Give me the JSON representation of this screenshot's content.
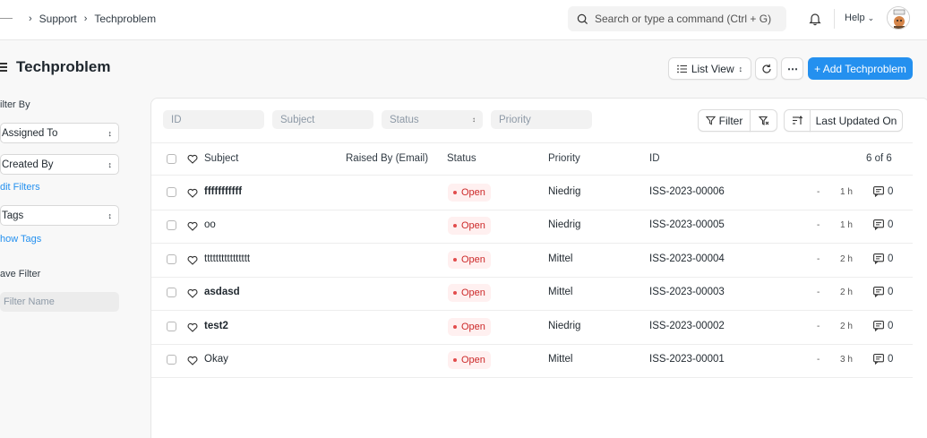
{
  "breadcrumb": {
    "items": [
      "Support",
      "Techproblem"
    ]
  },
  "search": {
    "placeholder": "Search or type a command (Ctrl + G)"
  },
  "navbar": {
    "help_label": "Help"
  },
  "page": {
    "title": "Techproblem",
    "list_view_label": "List View",
    "add_button_label": "+ Add Techproblem"
  },
  "sidebar": {
    "filter_by_label": "ilter By",
    "assigned_to_label": "Assigned To",
    "created_by_label": "Created By",
    "edit_filters_label": "dit Filters",
    "tags_label": "Tags",
    "show_tags_label": "how Tags",
    "save_filter_label": "ave Filter",
    "filter_name_placeholder": "Filter Name"
  },
  "filters": {
    "id_placeholder": "ID",
    "subject_placeholder": "Subject",
    "status_placeholder": "Status",
    "priority_placeholder": "Priority",
    "filter_button_label": "Filter",
    "sort_label": "Last Updated On"
  },
  "table": {
    "headers": {
      "subject": "Subject",
      "raised_by": "Raised By (Email)",
      "status": "Status",
      "priority": "Priority",
      "id": "ID",
      "count": "6 of 6"
    },
    "rows": [
      {
        "subject": "fffffffffff",
        "status": "Open",
        "priority": "Niedrig",
        "id": "ISS-2023-00006",
        "dash": "-",
        "time": "1 h",
        "comments": "0"
      },
      {
        "subject": "oo",
        "status": "Open",
        "priority": "Niedrig",
        "id": "ISS-2023-00005",
        "dash": "-",
        "time": "1 h",
        "comments": "0"
      },
      {
        "subject": "tttttttttttttttt",
        "status": "Open",
        "priority": "Mittel",
        "id": "ISS-2023-00004",
        "dash": "-",
        "time": "2 h",
        "comments": "0"
      },
      {
        "subject": "asdasd",
        "status": "Open",
        "priority": "Mittel",
        "id": "ISS-2023-00003",
        "dash": "-",
        "time": "2 h",
        "comments": "0"
      },
      {
        "subject": "test2",
        "status": "Open",
        "priority": "Niedrig",
        "id": "ISS-2023-00002",
        "dash": "-",
        "time": "2 h",
        "comments": "0"
      },
      {
        "subject": "Okay",
        "status": "Open",
        "priority": "Mittel",
        "id": "ISS-2023-00001",
        "dash": "-",
        "time": "3 h",
        "comments": "0"
      }
    ]
  },
  "colors": {
    "primary": "#2490ef",
    "open_text": "#cc2929",
    "open_bg": "#fff0f0"
  }
}
